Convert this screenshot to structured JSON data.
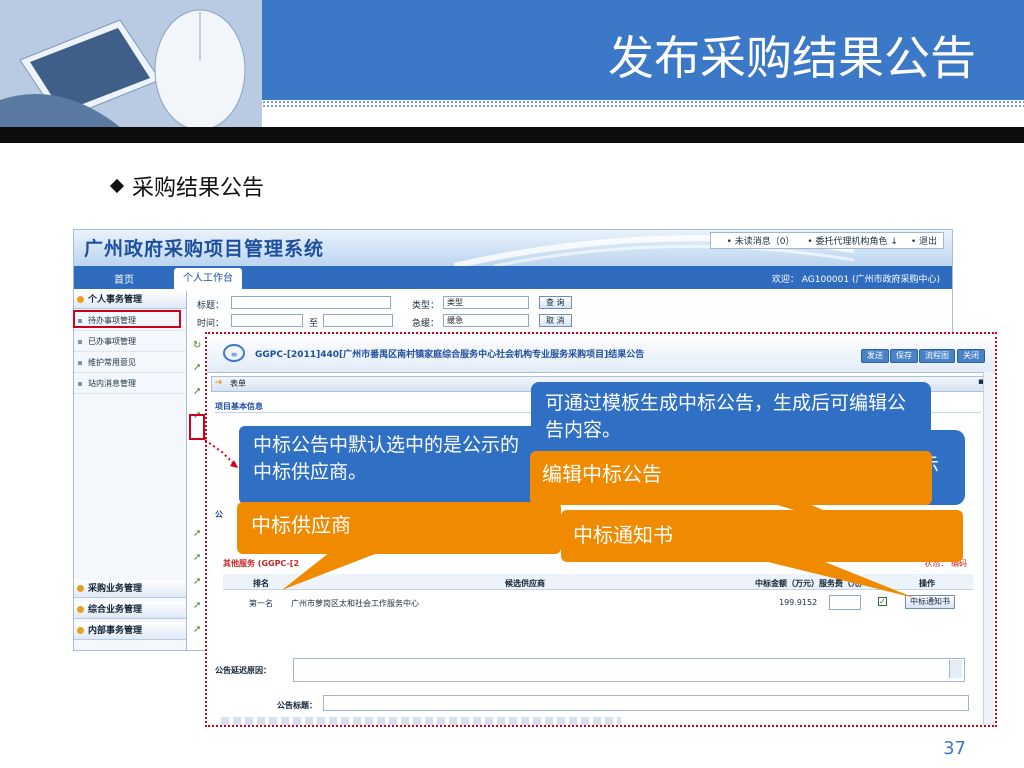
{
  "slide": {
    "title": "发布采购结果公告",
    "bullet": "采购结果公告",
    "page_number": "37"
  },
  "system": {
    "title": "广州政府采购项目管理系统",
    "top_links": [
      "• 未读消息（0）",
      "• 委托代理机构角色 ↓",
      "• 退出"
    ],
    "nav_home": "首页",
    "nav_tab": "个人工作台",
    "welcome": "欢迎： AG100001 (广州市政府采购中心)"
  },
  "sidebar": {
    "head1": "个人事务管理",
    "items": [
      "待办事项管理",
      "已办事项管理",
      "维护常用意见",
      "站内消息管理"
    ],
    "head2": "采购业务管理",
    "head3": "综合业务管理",
    "head4": "内部事务管理"
  },
  "filter": {
    "title_label": "标题：",
    "type_label": "类型：",
    "type_value": "类型",
    "query_btn": "查 询",
    "time_label": "时间：",
    "to_label": "至",
    "urgency_label": "急缓：",
    "urgency_value": "缓急",
    "cancel_btn": "取 消"
  },
  "dialog": {
    "title": "GGPC-[2011]440[广州市番禺区南村镇家庭综合服务中心社会机构专业服务采购项目]结果公告",
    "buttons": [
      "发送",
      "保存",
      "流程图",
      "关闭"
    ],
    "form_label": "表单",
    "section_basic": "项目基本信息",
    "section_ann": "公",
    "other_services": "其他服务 (GGPC-[2",
    "other_right": "状态： 编码",
    "table_headers": [
      "排名",
      "候选供应商",
      "中标金额（万元）",
      "服务费（元）",
      "操作"
    ],
    "row": {
      "rank": "第一名",
      "supplier": "广州市萝岗区太和社会工作服务中心",
      "amount": "199.9152",
      "action": "中标通知书"
    },
    "delay_label": "公告延迟原因：",
    "ann_title_label": "公告标题："
  },
  "callouts": {
    "default_supplier": "中标公告中默认选中的是公示的中标供应商。",
    "template": "可通过模板生成中标公告，生成后可编辑公告内容。",
    "template_tail": "示",
    "edit": "编辑中标公告",
    "supplier": "中标供应商",
    "notice": "中标通知书"
  },
  "colors": {
    "header_blue": "#3c78c8",
    "callout_blue": "#2f6fc4",
    "callout_orange": "#f08a00",
    "highlight_red": "#d0021b"
  }
}
